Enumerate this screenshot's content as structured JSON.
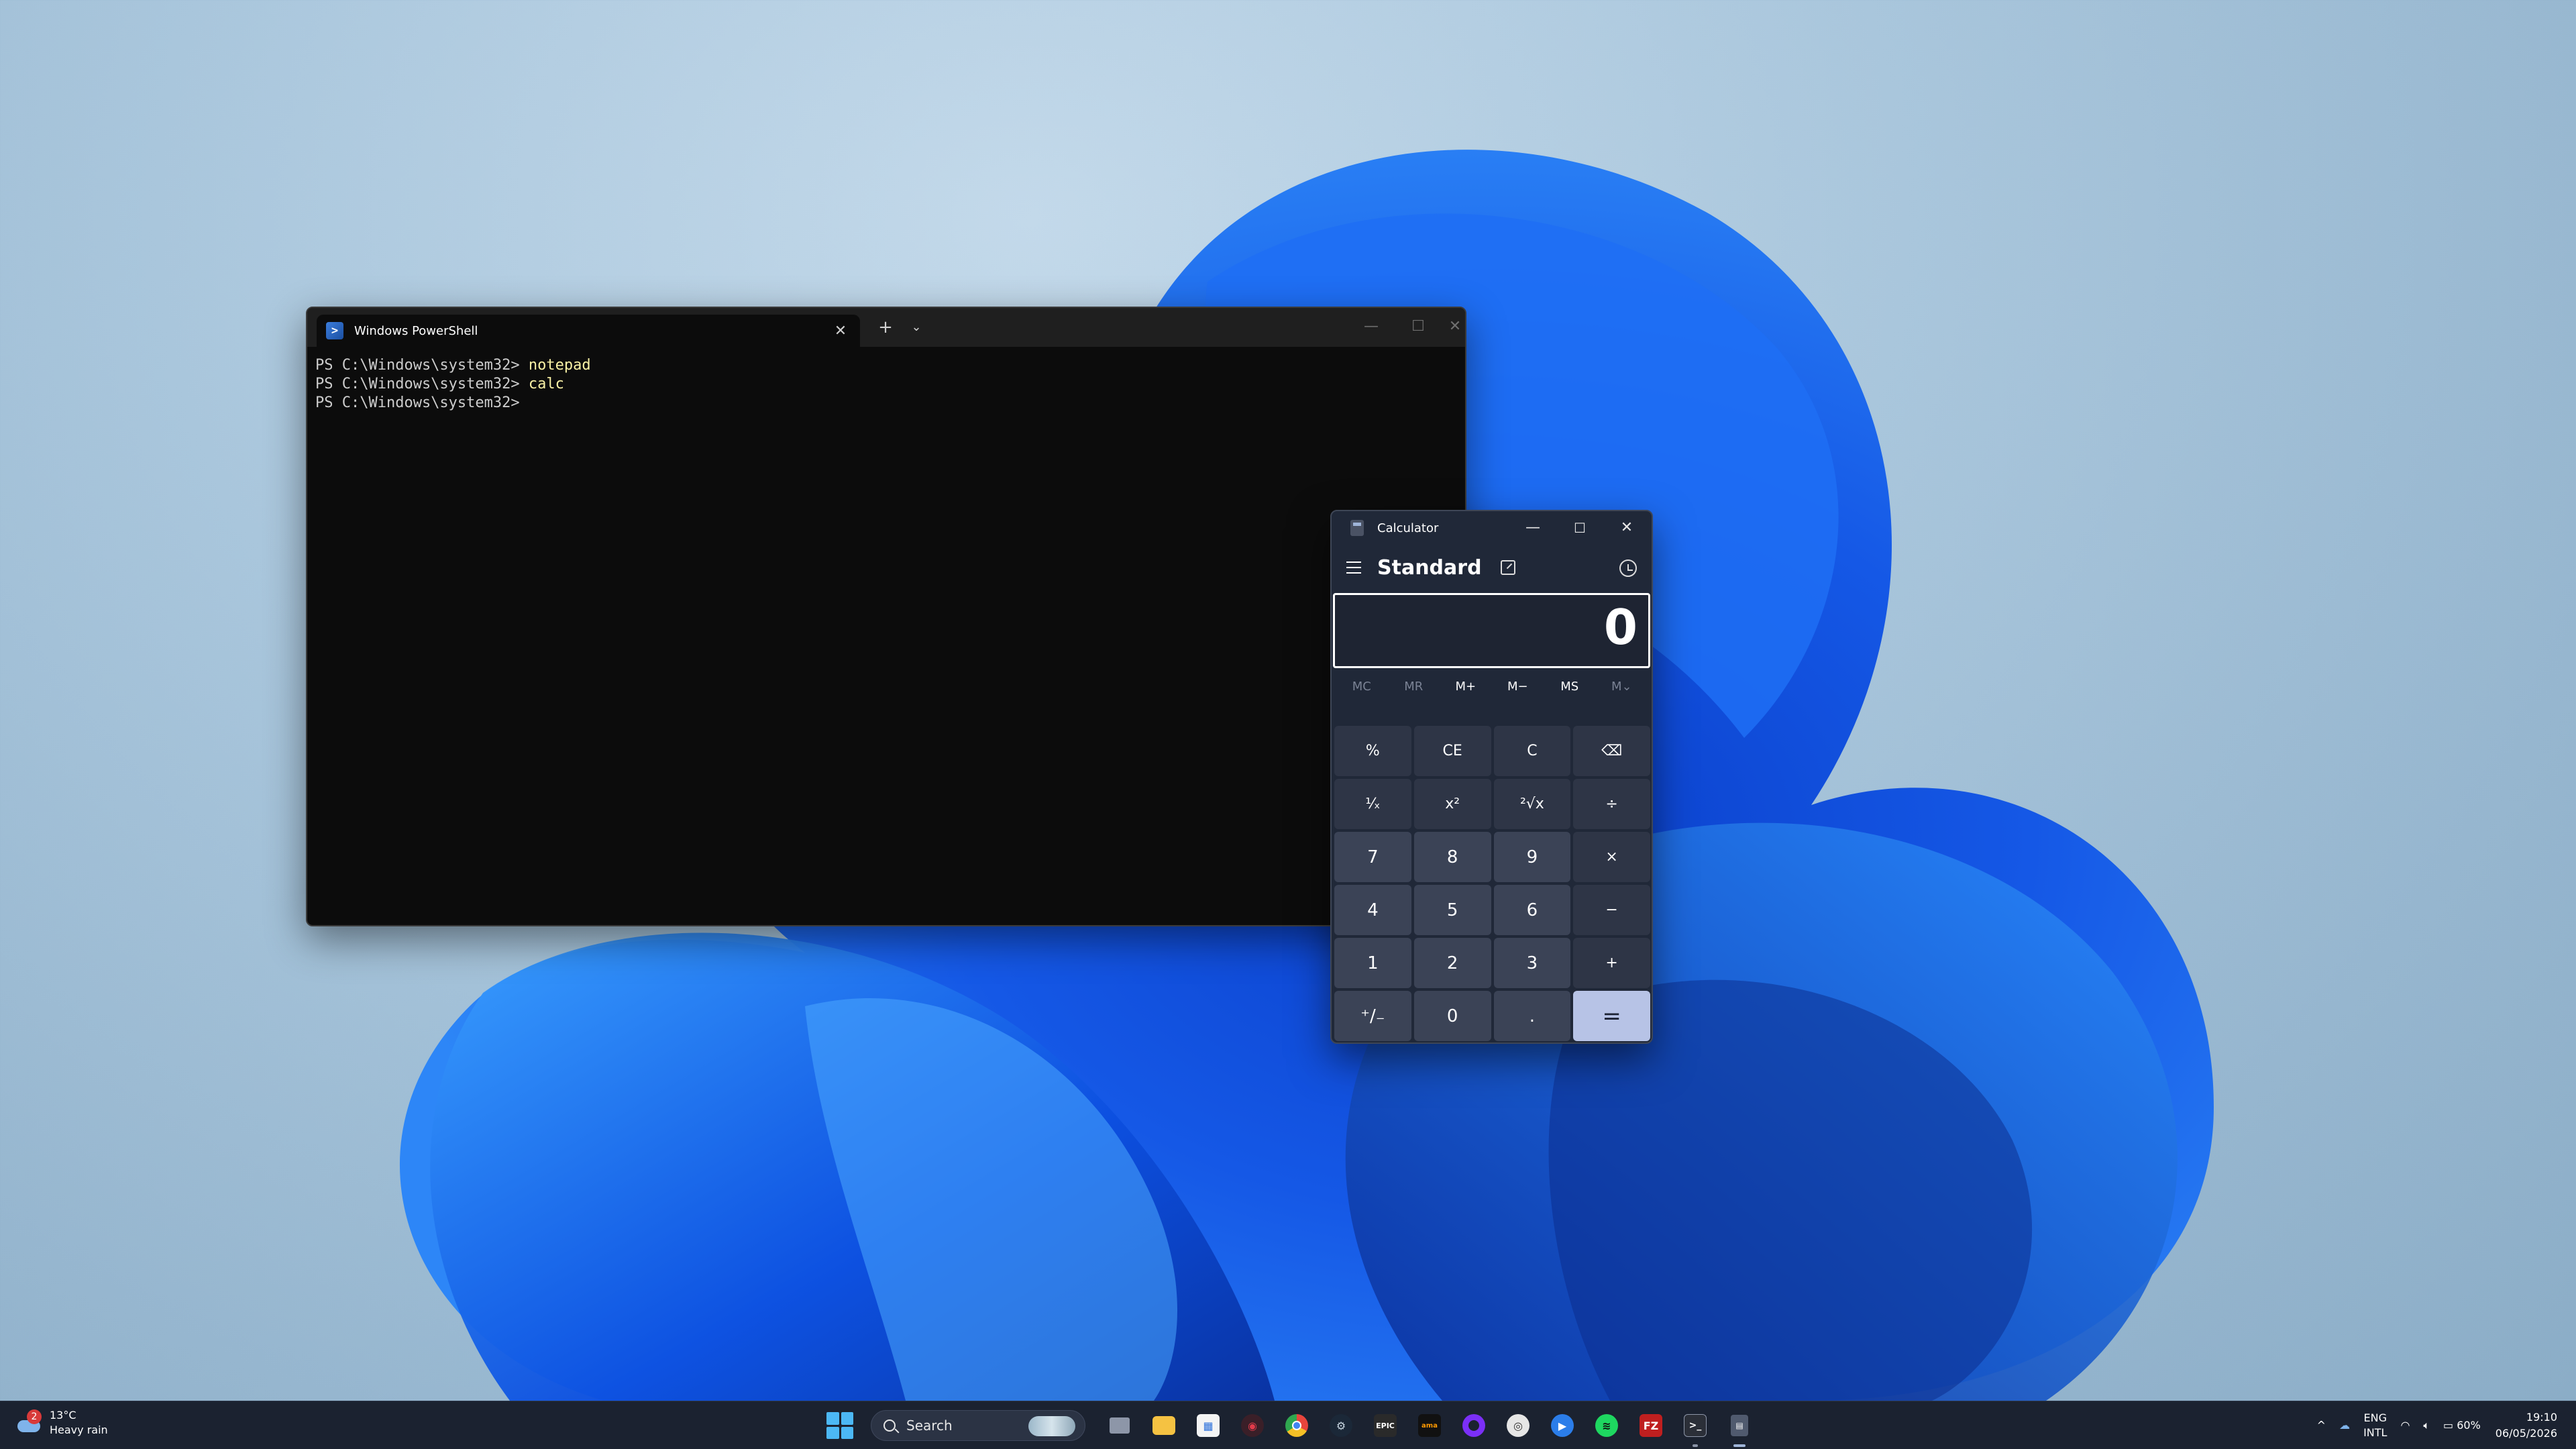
{
  "terminal": {
    "tab_title": "Windows PowerShell",
    "lines": [
      {
        "prompt": "PS C:\\Windows\\system32> ",
        "command": "notepad"
      },
      {
        "prompt": "PS C:\\Windows\\system32> ",
        "command": "calc"
      },
      {
        "prompt": "PS C:\\Windows\\system32> ",
        "command": ""
      }
    ]
  },
  "calculator": {
    "title": "Calculator",
    "mode": "Standard",
    "display": "0",
    "memory": [
      "MC",
      "MR",
      "M+",
      "M−",
      "MS",
      "M⌄"
    ],
    "keys": [
      "%",
      "CE",
      "C",
      "⌫",
      "¹⁄ₓ",
      "x²",
      "²√x",
      "÷",
      "7",
      "8",
      "9",
      "×",
      "4",
      "5",
      "6",
      "−",
      "1",
      "2",
      "3",
      "+",
      "⁺/₋",
      "0",
      ".",
      "="
    ]
  },
  "taskbar": {
    "weather_temp": "13°C",
    "weather_desc": "Heavy rain",
    "weather_badge": "2",
    "search_label": "Search",
    "lang_line1": "ENG",
    "lang_line2": "INTL",
    "battery": "60%",
    "time": "19:10",
    "date": "06/05/2026"
  }
}
